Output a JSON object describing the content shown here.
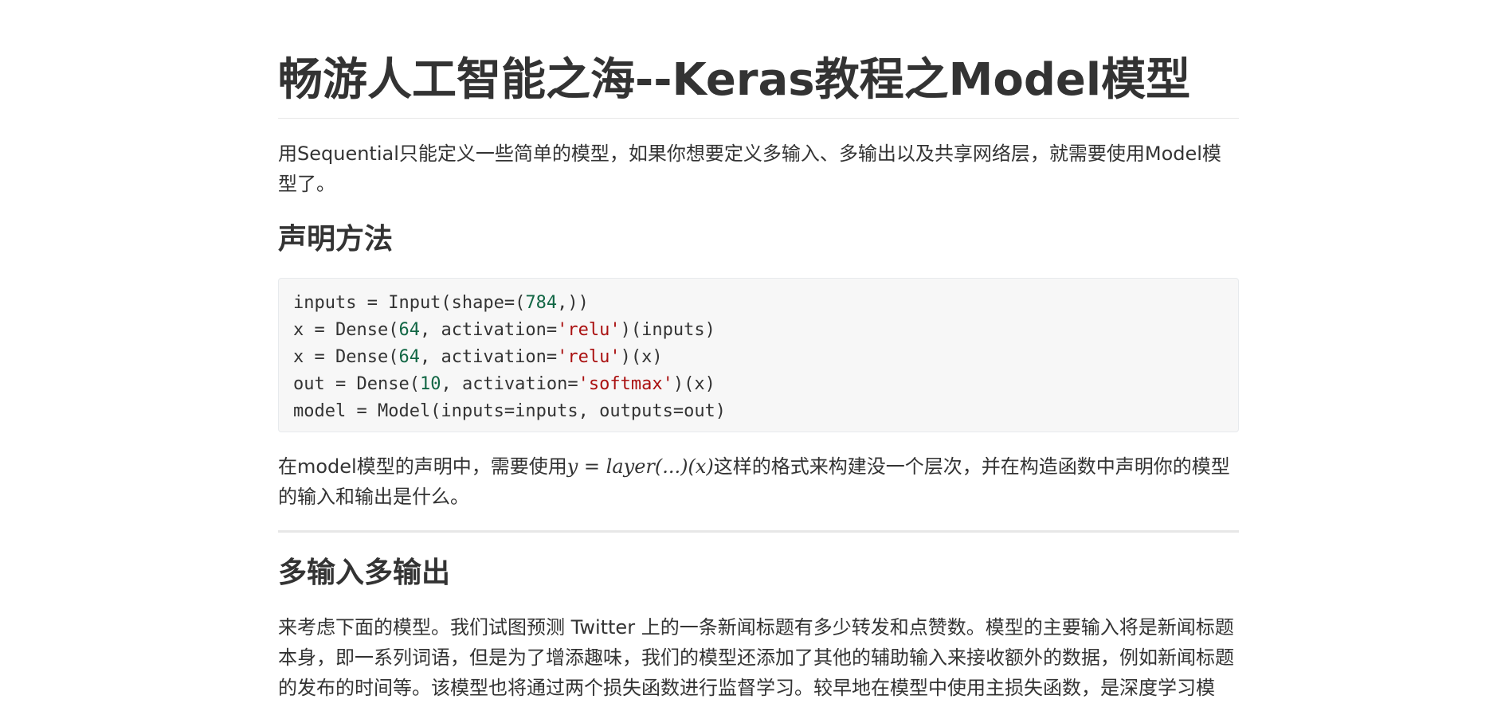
{
  "article": {
    "title": "畅游人工智能之海--Keras教程之Model模型",
    "intro": "用Sequential只能定义一些简单的模型，如果你想要定义多输入、多输出以及共享网络层，就需要使用Model模型了。",
    "section_declaration": {
      "heading": "声明方法",
      "code_lines": [
        [
          {
            "t": "inputs = Input(shape=("
          },
          {
            "t": "784",
            "k": "num"
          },
          {
            "t": ",))"
          }
        ],
        [
          {
            "t": "x = Dense("
          },
          {
            "t": "64",
            "k": "num"
          },
          {
            "t": ", activation="
          },
          {
            "t": "'relu'",
            "k": "str"
          },
          {
            "t": ")(inputs)"
          }
        ],
        [
          {
            "t": "x = Dense("
          },
          {
            "t": "64",
            "k": "num"
          },
          {
            "t": ", activation="
          },
          {
            "t": "'relu'",
            "k": "str"
          },
          {
            "t": ")(x)"
          }
        ],
        [
          {
            "t": "out = Dense("
          },
          {
            "t": "10",
            "k": "num"
          },
          {
            "t": ", activation="
          },
          {
            "t": "'softmax'",
            "k": "str"
          },
          {
            "t": ")(x)"
          }
        ],
        [
          {
            "t": "model = Model(inputs=inputs, outputs=out)"
          }
        ]
      ],
      "paragraph_before_math": "在model模型的声明中，需要使用",
      "math_expression": "y = layer(...)(x)",
      "paragraph_after_math": "这样的格式来构建没一个层次，并在构造函数中声明你的模型的输入和输出是什么。"
    },
    "section_multi_io": {
      "heading": "多输入多输出",
      "paragraph": "来考虑下面的模型。我们试图预测 Twitter 上的一条新闻标题有多少转发和点赞数。模型的主要输入将是新闻标题本身，即一系列词语，但是为了增添趣味，我们的模型还添加了其他的辅助输入来接收额外的数据，例如新闻标题的发布的时间等。该模型也将通过两个损失函数进行监督学习。较早地在模型中使用主损失函数，是深度学习模"
    }
  },
  "colors": {
    "text": "#333333",
    "code_background": "#f7f7f7",
    "code_number": "#116644",
    "code_string": "#aa1111",
    "rule": "#e7e7e7"
  }
}
